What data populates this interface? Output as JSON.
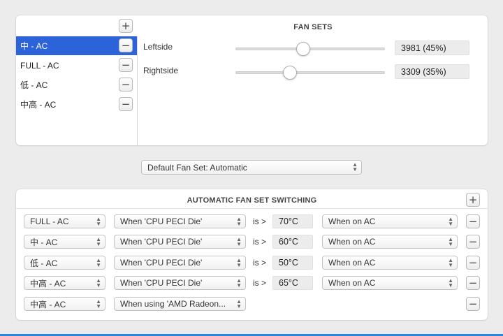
{
  "fan_sets": {
    "title": "FAN SETS",
    "add_label": "+",
    "remove_label": "−",
    "items": [
      {
        "label": "中 - AC",
        "selected": true
      },
      {
        "label": "FULL - AC",
        "selected": false
      },
      {
        "label": "低 - AC",
        "selected": false
      },
      {
        "label": "中高 - AC",
        "selected": false
      }
    ],
    "fans": [
      {
        "name": "Leftside",
        "value_text": "3981 (45%)",
        "percent": 45
      },
      {
        "name": "Rightside",
        "value_text": "3309 (35%)",
        "percent": 35
      }
    ]
  },
  "default_fan_set": {
    "label": "Default Fan Set: Automatic"
  },
  "switching": {
    "title": "AUTOMATIC FAN SET SWITCHING",
    "add_label": "+",
    "remove_label": "−",
    "operator": "is >",
    "rules": [
      {
        "fan_set": "FULL - AC",
        "condition": "When 'CPU PECI Die'",
        "threshold": "70°C",
        "power": "When on AC"
      },
      {
        "fan_set": "中 - AC",
        "condition": "When 'CPU PECI Die'",
        "threshold": "60°C",
        "power": "When on AC"
      },
      {
        "fan_set": "低 - AC",
        "condition": "When 'CPU PECI Die'",
        "threshold": "50°C",
        "power": "When on AC"
      },
      {
        "fan_set": "中高 - AC",
        "condition": "When 'CPU PECI Die'",
        "threshold": "65°C",
        "power": "When on AC"
      },
      {
        "fan_set": "中高 - AC",
        "condition": "When using 'AMD Radeon...",
        "threshold": "",
        "power": ""
      }
    ]
  },
  "colors": {
    "selection": "#2d63d8",
    "window_bg": "#ececec",
    "bottom_accent": "#2d86d9"
  },
  "icons": {
    "add": "plus-icon",
    "remove": "minus-icon",
    "popup_arrows": "up-down-chevron-icon"
  }
}
